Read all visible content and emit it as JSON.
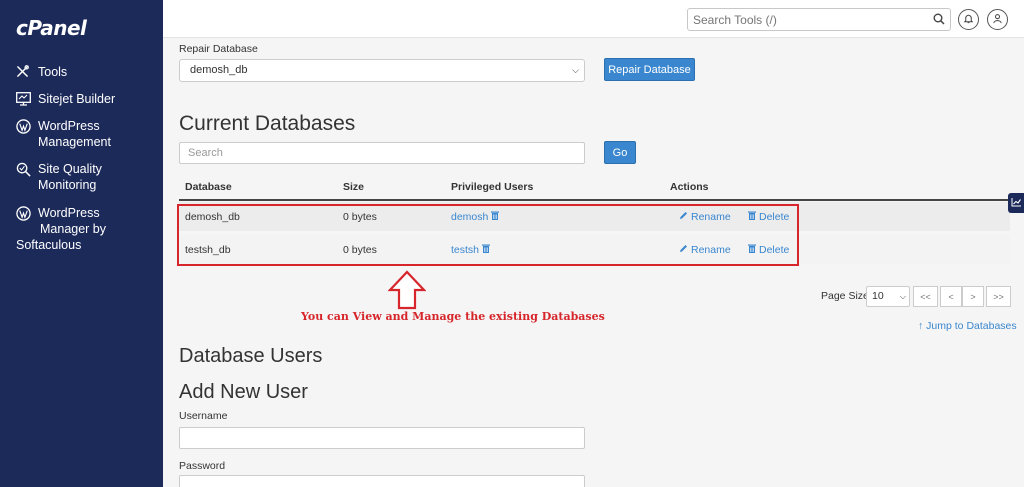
{
  "sidebar": {
    "logo": "cPanel",
    "items": [
      {
        "label": "Tools",
        "icon": "tools-icon"
      },
      {
        "label": "Sitejet Builder",
        "icon": "monitor-icon"
      },
      {
        "label_line1": "WordPress",
        "label_line2": "Management",
        "icon": "wordpress-icon"
      },
      {
        "label_line1": "Site Quality",
        "label_line2": "Monitoring",
        "icon": "search-icon"
      },
      {
        "label_line1": "WordPress",
        "label_line2": "Manager by",
        "label_line3": "Softaculous",
        "icon": "wordpress-icon"
      }
    ]
  },
  "topbar": {
    "search_placeholder": "Search Tools (/)"
  },
  "repair": {
    "label": "Repair Database",
    "selected": "demosh_db",
    "button": "Repair Database"
  },
  "current": {
    "heading": "Current Databases",
    "search_placeholder": "Search",
    "go_button": "Go",
    "columns": [
      "Database",
      "Size",
      "Privileged Users",
      "Actions"
    ],
    "rows": [
      {
        "database": "demosh_db",
        "size": "0 bytes",
        "user": "demosh"
      },
      {
        "database": "testsh_db",
        "size": "0 bytes",
        "user": "testsh"
      }
    ],
    "rename_label": "Rename",
    "delete_label": "Delete"
  },
  "annotation": "You can View and Manage the existing Databases",
  "pagination": {
    "page_size_label": "Page Size",
    "page_size_value": "10",
    "first": "<<",
    "prev": "<",
    "next": ">",
    "last": ">>"
  },
  "jump_link": "Jump to Databases",
  "users": {
    "heading": "Database Users",
    "add_heading": "Add New User",
    "username_label": "Username",
    "password_label": "Password"
  },
  "colors": {
    "sidebar": "#1c2a5a",
    "accent": "#3a87cf",
    "highlight": "#d6262b"
  }
}
